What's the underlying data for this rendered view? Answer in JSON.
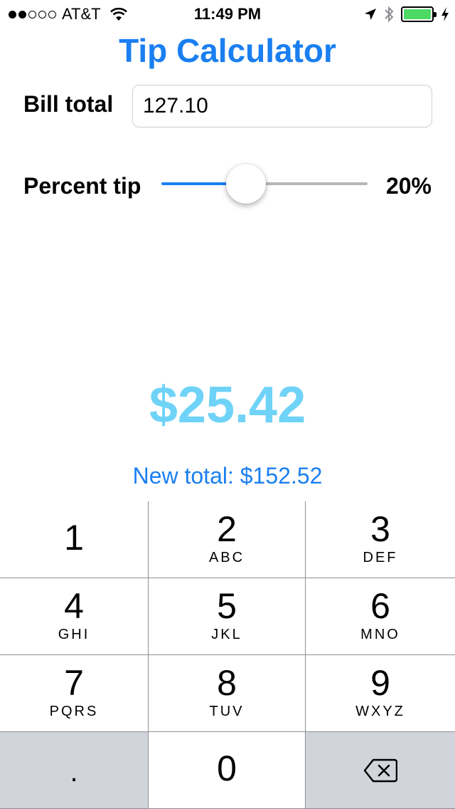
{
  "status_bar": {
    "carrier": "AT&T",
    "time": "11:49 PM",
    "signal_bars_filled": 2,
    "signal_bars_total": 5,
    "battery_level": 1.0,
    "icons": [
      "wifi-icon",
      "location-arrow-icon",
      "bluetooth-icon",
      "battery-icon",
      "charging-icon"
    ]
  },
  "title": "Tip Calculator",
  "bill": {
    "label": "Bill total",
    "value": "127.10"
  },
  "tip": {
    "label": "Percent tip",
    "percent_display": "20%",
    "slider_fraction": 0.41
  },
  "result": {
    "tip_amount": "$25.42",
    "new_total": "New total: $152.52"
  },
  "keypad": {
    "keys": [
      {
        "num": "1",
        "letters": ""
      },
      {
        "num": "2",
        "letters": "ABC"
      },
      {
        "num": "3",
        "letters": "DEF"
      },
      {
        "num": "4",
        "letters": "GHI"
      },
      {
        "num": "5",
        "letters": "JKL"
      },
      {
        "num": "6",
        "letters": "MNO"
      },
      {
        "num": "7",
        "letters": "PQRS"
      },
      {
        "num": "8",
        "letters": "TUV"
      },
      {
        "num": "9",
        "letters": "WXYZ"
      },
      {
        "num": ".",
        "letters": ""
      },
      {
        "num": "0",
        "letters": ""
      },
      {
        "num": "",
        "letters": "",
        "icon": "backspace-icon"
      }
    ]
  },
  "colors": {
    "accent": "#1a7ff0",
    "tip_amount": "#6fd3f7",
    "battery": "#4cd964",
    "keypad_gray": "#d1d5db"
  }
}
